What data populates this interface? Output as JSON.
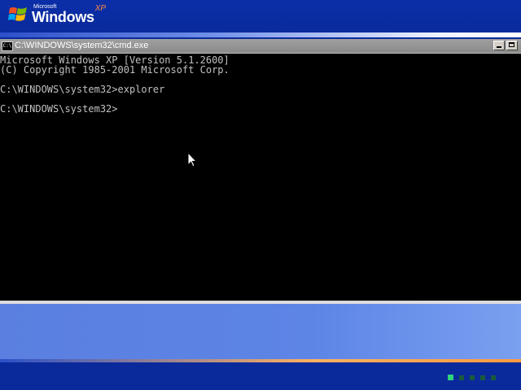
{
  "branding": {
    "microsoft": "Microsoft",
    "windows": "Windows",
    "xp": "XP"
  },
  "window": {
    "title": "C:\\WINDOWS\\system32\\cmd.exe",
    "icon_label": "C:\\",
    "minimize_icon": "minimize-icon",
    "maximize_icon": "maximize-icon"
  },
  "console": {
    "lines": [
      "Microsoft Windows XP [Version 5.1.2600]",
      "(C) Copyright 1985-2001 Microsoft Corp.",
      "",
      "C:\\WINDOWS\\system32>explorer",
      "",
      "C:\\WINDOWS\\system32>"
    ]
  },
  "progress": {
    "total": 5,
    "active_index": 0,
    "active_color": "#2fd37a",
    "inactive_color": "#1a5a3c"
  },
  "colors": {
    "background": "#0a2a9c",
    "console_bg": "#000000",
    "console_text": "#c0c0c0",
    "accent_orange": "#ff8a3d"
  }
}
